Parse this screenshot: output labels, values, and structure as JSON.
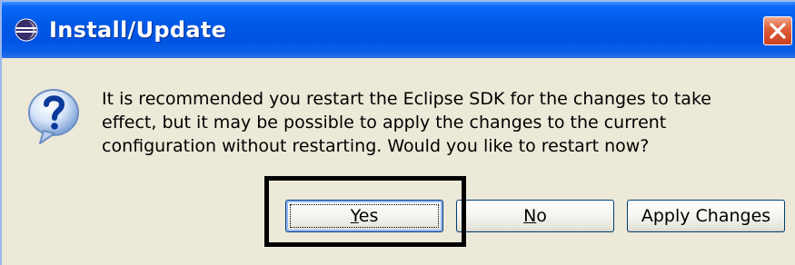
{
  "window": {
    "title": "Install/Update",
    "app_icon": "eclipse-icon",
    "close_icon": "close-icon"
  },
  "dialog": {
    "icon": "question-icon",
    "message_lines": [
      "It is recommended you restart the Eclipse SDK for the changes to take",
      "effect, but it may be possible to apply the changes to the current",
      "configuration without restarting. Would you like to restart now?"
    ],
    "buttons": {
      "yes": {
        "mnemonic": "Y",
        "rest": "es"
      },
      "no": {
        "mnemonic": "N",
        "rest": "o"
      },
      "apply": "Apply Changes"
    }
  },
  "colors": {
    "titlebar": "#0054e3",
    "dialog_background": "#ece9d8",
    "close_button": "#e0603b",
    "annotation_border": "#000000"
  }
}
